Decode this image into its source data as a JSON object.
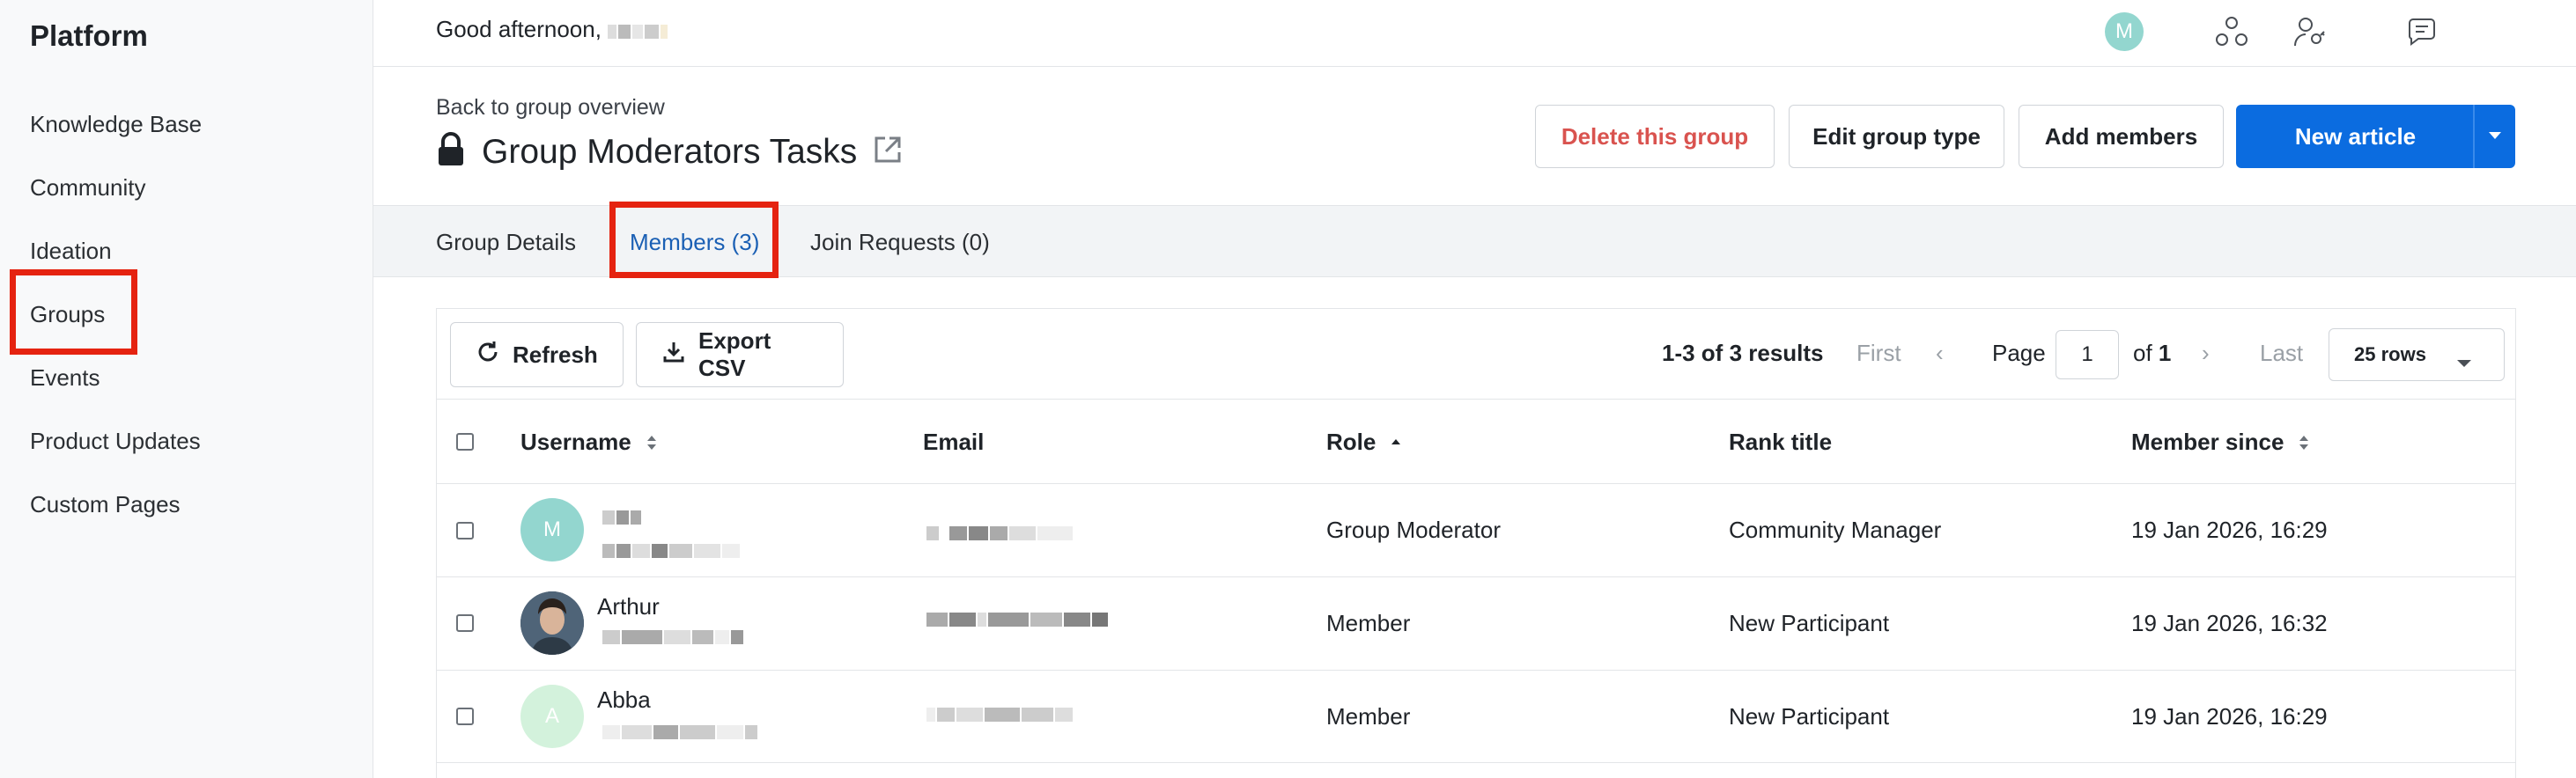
{
  "sidebar": {
    "title": "Platform",
    "items": [
      {
        "label": "Knowledge Base"
      },
      {
        "label": "Community"
      },
      {
        "label": "Ideation"
      },
      {
        "label": "Groups"
      },
      {
        "label": "Events"
      },
      {
        "label": "Product Updates"
      },
      {
        "label": "Custom Pages"
      }
    ]
  },
  "topbar": {
    "greeting": "Good afternoon,",
    "icons": [
      "community-icon",
      "user-settings-icon",
      "chat-icon"
    ],
    "avatar_initial": "M",
    "avatar_color": "#93d6cf"
  },
  "header": {
    "back_link": "Back to group overview",
    "title": "Group Moderators Tasks",
    "buttons": {
      "delete": "Delete this group",
      "edit_type": "Edit group type",
      "add_members": "Add members",
      "new_article": "New article"
    }
  },
  "tabs": [
    {
      "label": "Group Details",
      "active": false
    },
    {
      "label": "Members (3)",
      "active": true
    },
    {
      "label": "Join Requests (0)",
      "active": false
    }
  ],
  "toolbar": {
    "refresh": "Refresh",
    "export": "Export CSV",
    "results": "1-3 of 3 results",
    "first": "First",
    "page_label": "Page",
    "page_value": "1",
    "of_label": "of",
    "total_pages": "1",
    "last": "Last",
    "rows": "25 rows"
  },
  "table": {
    "columns": [
      "Username",
      "Email",
      "Role",
      "Rank title",
      "Member since"
    ],
    "rows": [
      {
        "name": "",
        "avatar_initial": "M",
        "avatar_color": "#93d6cf",
        "role": "Group Moderator",
        "rank": "Community Manager",
        "since": "19 Jan 2026, 16:29"
      },
      {
        "name": "Arthur",
        "avatar_initial": "",
        "avatar_color": "#3b4a5a",
        "role": "Member",
        "rank": "New Participant",
        "since": "19 Jan 2026, 16:32"
      },
      {
        "name": "Abba",
        "avatar_initial": "A",
        "avatar_color": "#d3f2dc",
        "role": "Member",
        "rank": "New Participant",
        "since": "19 Jan 2026, 16:29"
      }
    ]
  },
  "colors": {
    "primary": "#0b6ce0",
    "danger": "#d9534f",
    "highlight": "#e52310",
    "active_tab": "#1a5fb4"
  }
}
